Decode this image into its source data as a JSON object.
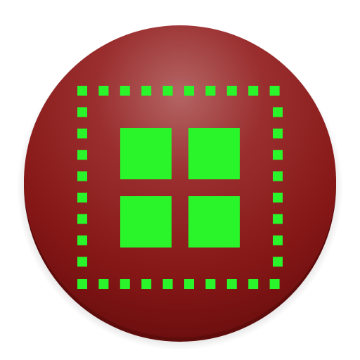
{
  "icon": {
    "name": "grid-layout-icon",
    "shape": "circle-badge",
    "colors": {
      "badge": "#8e1a1a",
      "badge_highlight": "#b85a5a",
      "badge_shadow": "#6a0f0f",
      "glyph": "#2af52a",
      "glyph_light": "#5cff5c"
    },
    "glyph": {
      "description_icon": "dashed-selection-frame-with-2x2-grid",
      "grid_rows": 2,
      "grid_cols": 2
    }
  }
}
